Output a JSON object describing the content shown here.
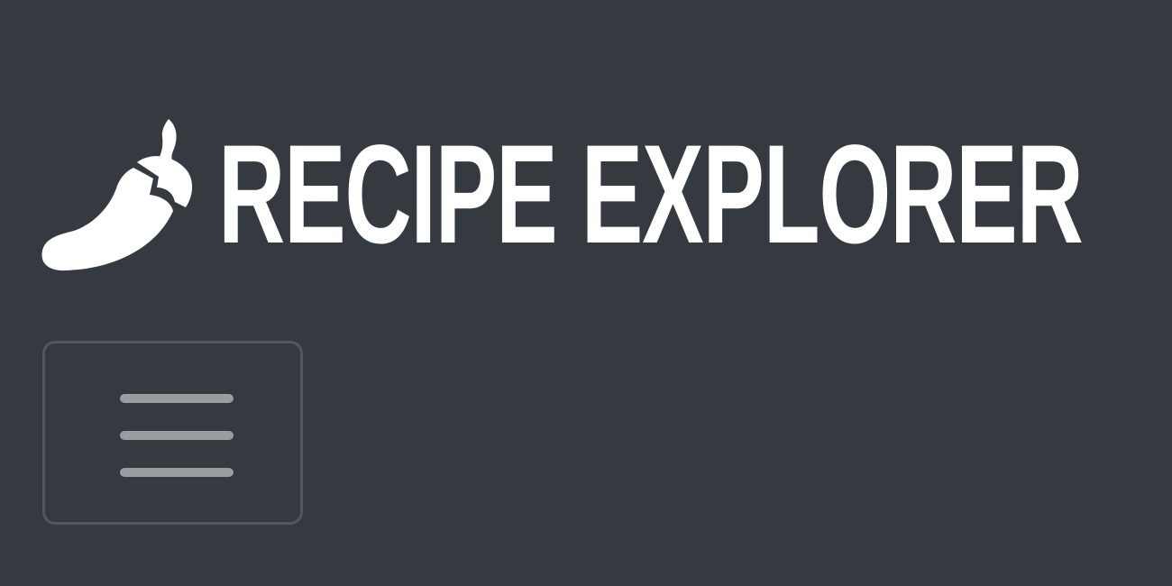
{
  "navbar": {
    "brand": {
      "icon": "pepper-hot-icon",
      "text": "Recipe Explorer"
    },
    "toggler": {
      "icon": "hamburger-menu-icon"
    }
  },
  "colors": {
    "background": "#343a40",
    "brand_text": "#ffffff",
    "toggler_icon": "#9a9da0",
    "toggler_border": "rgba(255,255,255,0.15)"
  }
}
